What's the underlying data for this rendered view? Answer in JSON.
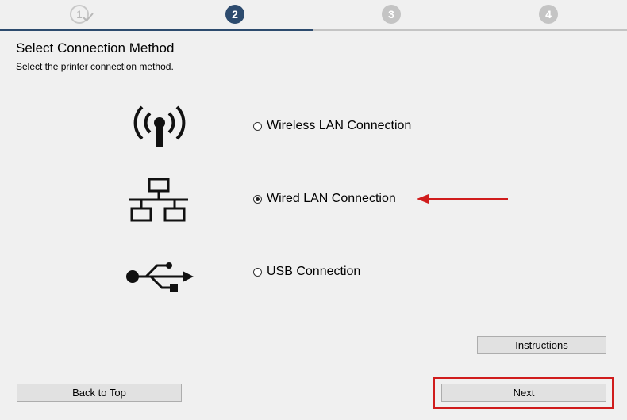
{
  "steps": [
    {
      "label": "1"
    },
    {
      "label": "2"
    },
    {
      "label": "3"
    },
    {
      "label": "4"
    }
  ],
  "header": {
    "title": "Select Connection Method",
    "subtitle": "Select the printer connection method."
  },
  "options": [
    {
      "label": "Wireless LAN Connection",
      "selected": false,
      "icon": "wireless-icon"
    },
    {
      "label": "Wired LAN Connection",
      "selected": true,
      "icon": "network-icon"
    },
    {
      "label": "USB Connection",
      "selected": false,
      "icon": "usb-icon"
    }
  ],
  "buttons": {
    "instructions": "Instructions",
    "back": "Back to Top",
    "next": "Next"
  },
  "colors": {
    "active_step": "#2d4b6e",
    "annotation": "#d01c1c"
  }
}
